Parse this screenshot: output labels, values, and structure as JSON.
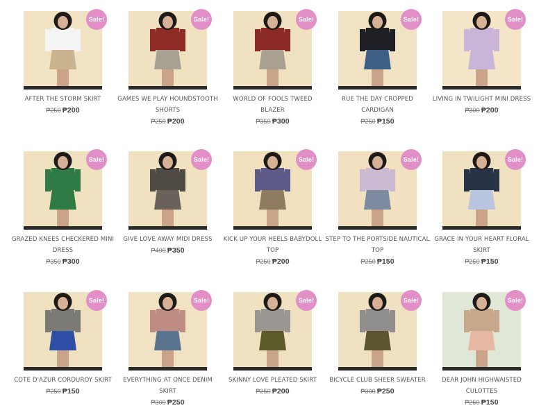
{
  "badge_label": "Sale!",
  "currency": "₱",
  "products": [
    {
      "name": "AFTER THE STORM SKIRT",
      "old_price": "₱250",
      "new_price": "₱200",
      "top": "#f4f4f4",
      "bottom": "#c9b48f",
      "bg": "#f0e2c2"
    },
    {
      "name": "GAMES WE PLAY HOUNDSTOOTH SHORTS",
      "old_price": "₱250",
      "new_price": "₱200",
      "top": "#8d2b24",
      "bottom": "#a8a093",
      "bg": "#f0e1c0"
    },
    {
      "name": "WORLD OF FOOLS TWEED BLAZER",
      "old_price": "₱350",
      "new_price": "₱300",
      "top": "#8b2a25",
      "bottom": "#aaa091",
      "bg": "#f0e1c0"
    },
    {
      "name": "RUE THE DAY CROPPED CARDIGAN",
      "old_price": "₱250",
      "new_price": "₱150",
      "top": "#1f1f26",
      "bottom": "#3d5f86",
      "bg": "#f2e2c4"
    },
    {
      "name": "LIVING IN TWILIGHT MINI DRESS",
      "old_price": "₱300",
      "new_price": "₱200",
      "top": "#c9b5d7",
      "bottom": "#c9b5d7",
      "bg": "#f4e4c8"
    },
    {
      "name": "GRAZED KNEES CHECKERED MINI DRESS",
      "old_price": "₱350",
      "new_price": "₱300",
      "top": "#2f7a45",
      "bottom": "#2f7a45",
      "bg": "#f0e1c0"
    },
    {
      "name": "GIVE LOVE AWAY MIDI DRESS",
      "old_price": "₱400",
      "new_price": "₱350",
      "top": "#4f4a44",
      "bottom": "#6a625a",
      "bg": "#f0e1c0"
    },
    {
      "name": "KICK UP YOUR HEELS BABYDOLL TOP",
      "old_price": "₱250",
      "new_price": "₱200",
      "top": "#5d5a87",
      "bottom": "#8f7b5f",
      "bg": "#f0e0bd"
    },
    {
      "name": "STEP TO THE PORTSIDE NAUTICAL TOP",
      "old_price": "₱250",
      "new_price": "₱150",
      "top": "#cbb9d4",
      "bottom": "#7d8aa0",
      "bg": "#f1e1c1"
    },
    {
      "name": "GRACE IN YOUR HEART FLORAL SKIRT",
      "old_price": "₱250",
      "new_price": "₱150",
      "top": "#283446",
      "bottom": "#b9c4de",
      "bg": "#f0e1c0"
    },
    {
      "name": "COTE D'AZUR CORDUROY SKIRT",
      "old_price": "₱250",
      "new_price": "₱150",
      "top": "#7c7a74",
      "bottom": "#2f4fa6",
      "bg": "#efe0bf"
    },
    {
      "name": "EVERYTHING AT ONCE DENIM SKIRT",
      "old_price": "₱300",
      "new_price": "₱250",
      "top": "#bf8c83",
      "bottom": "#5a7490",
      "bg": "#f0e2c3"
    },
    {
      "name": "SKINNY LOVE PLEATED SKIRT",
      "old_price": "₱250",
      "new_price": "₱200",
      "top": "#9a9793",
      "bottom": "#5d5a2c",
      "bg": "#f0e1c0"
    },
    {
      "name": "BICYCLE CLUB SHEER SWEATER",
      "old_price": "₱300",
      "new_price": "₱250",
      "top": "#8f8e8c",
      "bottom": "#5b5530",
      "bg": "#f0e1c0"
    },
    {
      "name": "DEAR JOHN HIGHWAISTED CULOTTES",
      "old_price": "₱250",
      "new_price": "₱150",
      "top": "#c7a88b",
      "bottom": "#e6b7a3",
      "bg": "#dfe7d6"
    }
  ]
}
